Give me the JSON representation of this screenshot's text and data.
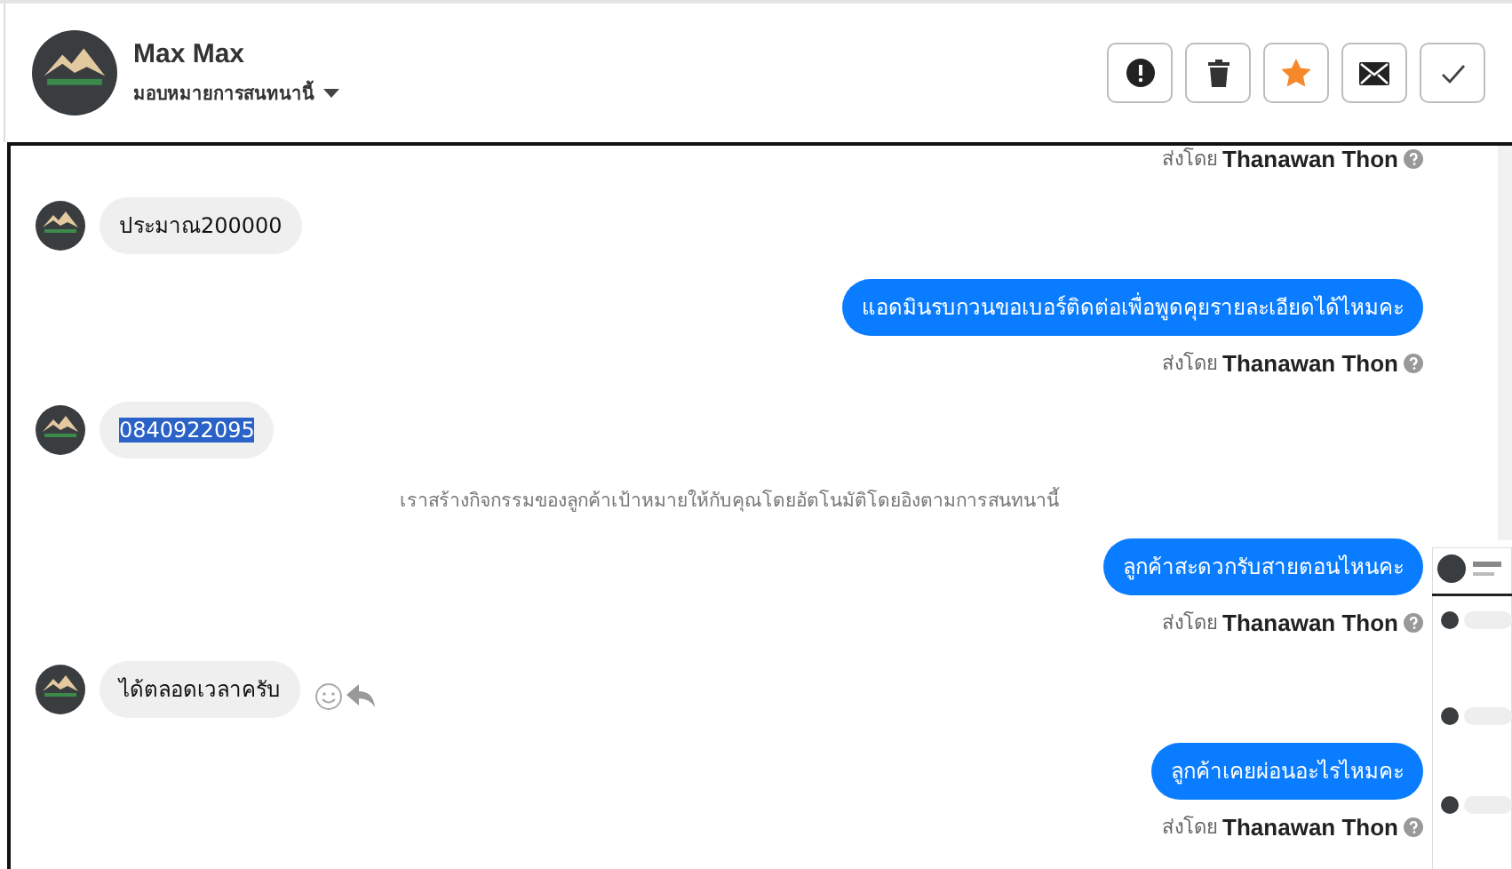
{
  "header": {
    "name": "Max Max",
    "assign_label": "มอบหมายการสนทนานี้"
  },
  "messages": [
    {
      "kind": "sender",
      "prefix": "ส่งโดย",
      "name": "Thanawan Thon"
    },
    {
      "kind": "incoming",
      "text": "ประมาณ200000",
      "selected": false
    },
    {
      "kind": "outgoing",
      "text": "แอดมินรบกวนขอเบอร์ติดต่อเพื่อพูดคุยรายละเอียดได้ไหมคะ"
    },
    {
      "kind": "sender",
      "prefix": "ส่งโดย",
      "name": "Thanawan Thon"
    },
    {
      "kind": "incoming",
      "text": "0840922095",
      "selected": true
    },
    {
      "kind": "system",
      "text": "เราสร้างกิจกรรมของลูกค้าเป้าหมายให้กับคุณโดยอัตโนมัติโดยอิงตามการสนทนานี้"
    },
    {
      "kind": "outgoing",
      "text": "ลูกค้าสะดวกรับสายตอนไหนคะ"
    },
    {
      "kind": "sender",
      "prefix": "ส่งโดย",
      "name": "Thanawan Thon"
    },
    {
      "kind": "incoming",
      "text": "ได้ตลอดเวลาครับ",
      "selected": false,
      "actions": true
    },
    {
      "kind": "outgoing",
      "text": "ลูกค้าเคยผ่อนอะไรไหมคะ"
    },
    {
      "kind": "sender",
      "prefix": "ส่งโดย",
      "name": "Thanawan Thon"
    }
  ]
}
